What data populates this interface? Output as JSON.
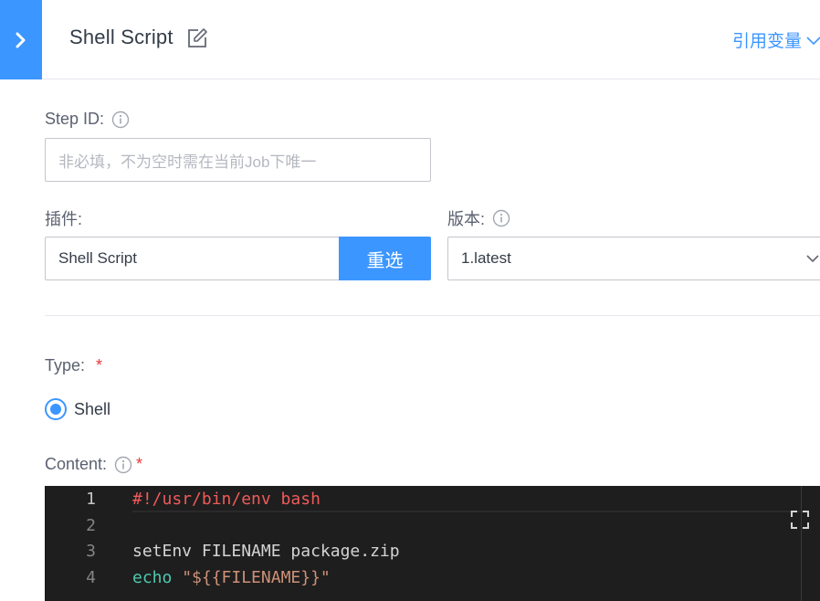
{
  "header": {
    "title": "Shell Script",
    "reference_variables_label": "引用变量"
  },
  "form": {
    "step_id": {
      "label": "Step ID:",
      "placeholder": "非必填，不为空时需在当前Job下唯一"
    },
    "plugin": {
      "label": "插件:",
      "value": "Shell Script",
      "reselect_label": "重选"
    },
    "version": {
      "label": "版本:",
      "value": "1.latest"
    },
    "type": {
      "label": "Type:",
      "required_mark": "*",
      "options": [
        {
          "label": "Shell",
          "selected": true
        }
      ]
    },
    "content": {
      "label": "Content:",
      "required_mark": "*"
    }
  },
  "editor": {
    "line_numbers": [
      "1",
      "2",
      "3",
      "4"
    ],
    "lines": {
      "l1": "#!/usr/bin/env bash",
      "l2": "",
      "l3": "setEnv FILENAME package.zip",
      "l4_cmd": "echo",
      "l4_arg": "\"${{FILENAME}}\""
    }
  },
  "colors": {
    "accent": "#3c96ff",
    "required": "#ea3636",
    "editor_bg": "#1e1e1e",
    "shebang": "#f05a5a",
    "keyword": "#4ec9b0",
    "string": "#ce9178"
  },
  "icons": {
    "collapse": "chevron-right-icon",
    "edit": "edit-icon",
    "info": "info-icon",
    "dropdown": "chevron-down-icon",
    "fullscreen": "fullscreen-icon"
  }
}
